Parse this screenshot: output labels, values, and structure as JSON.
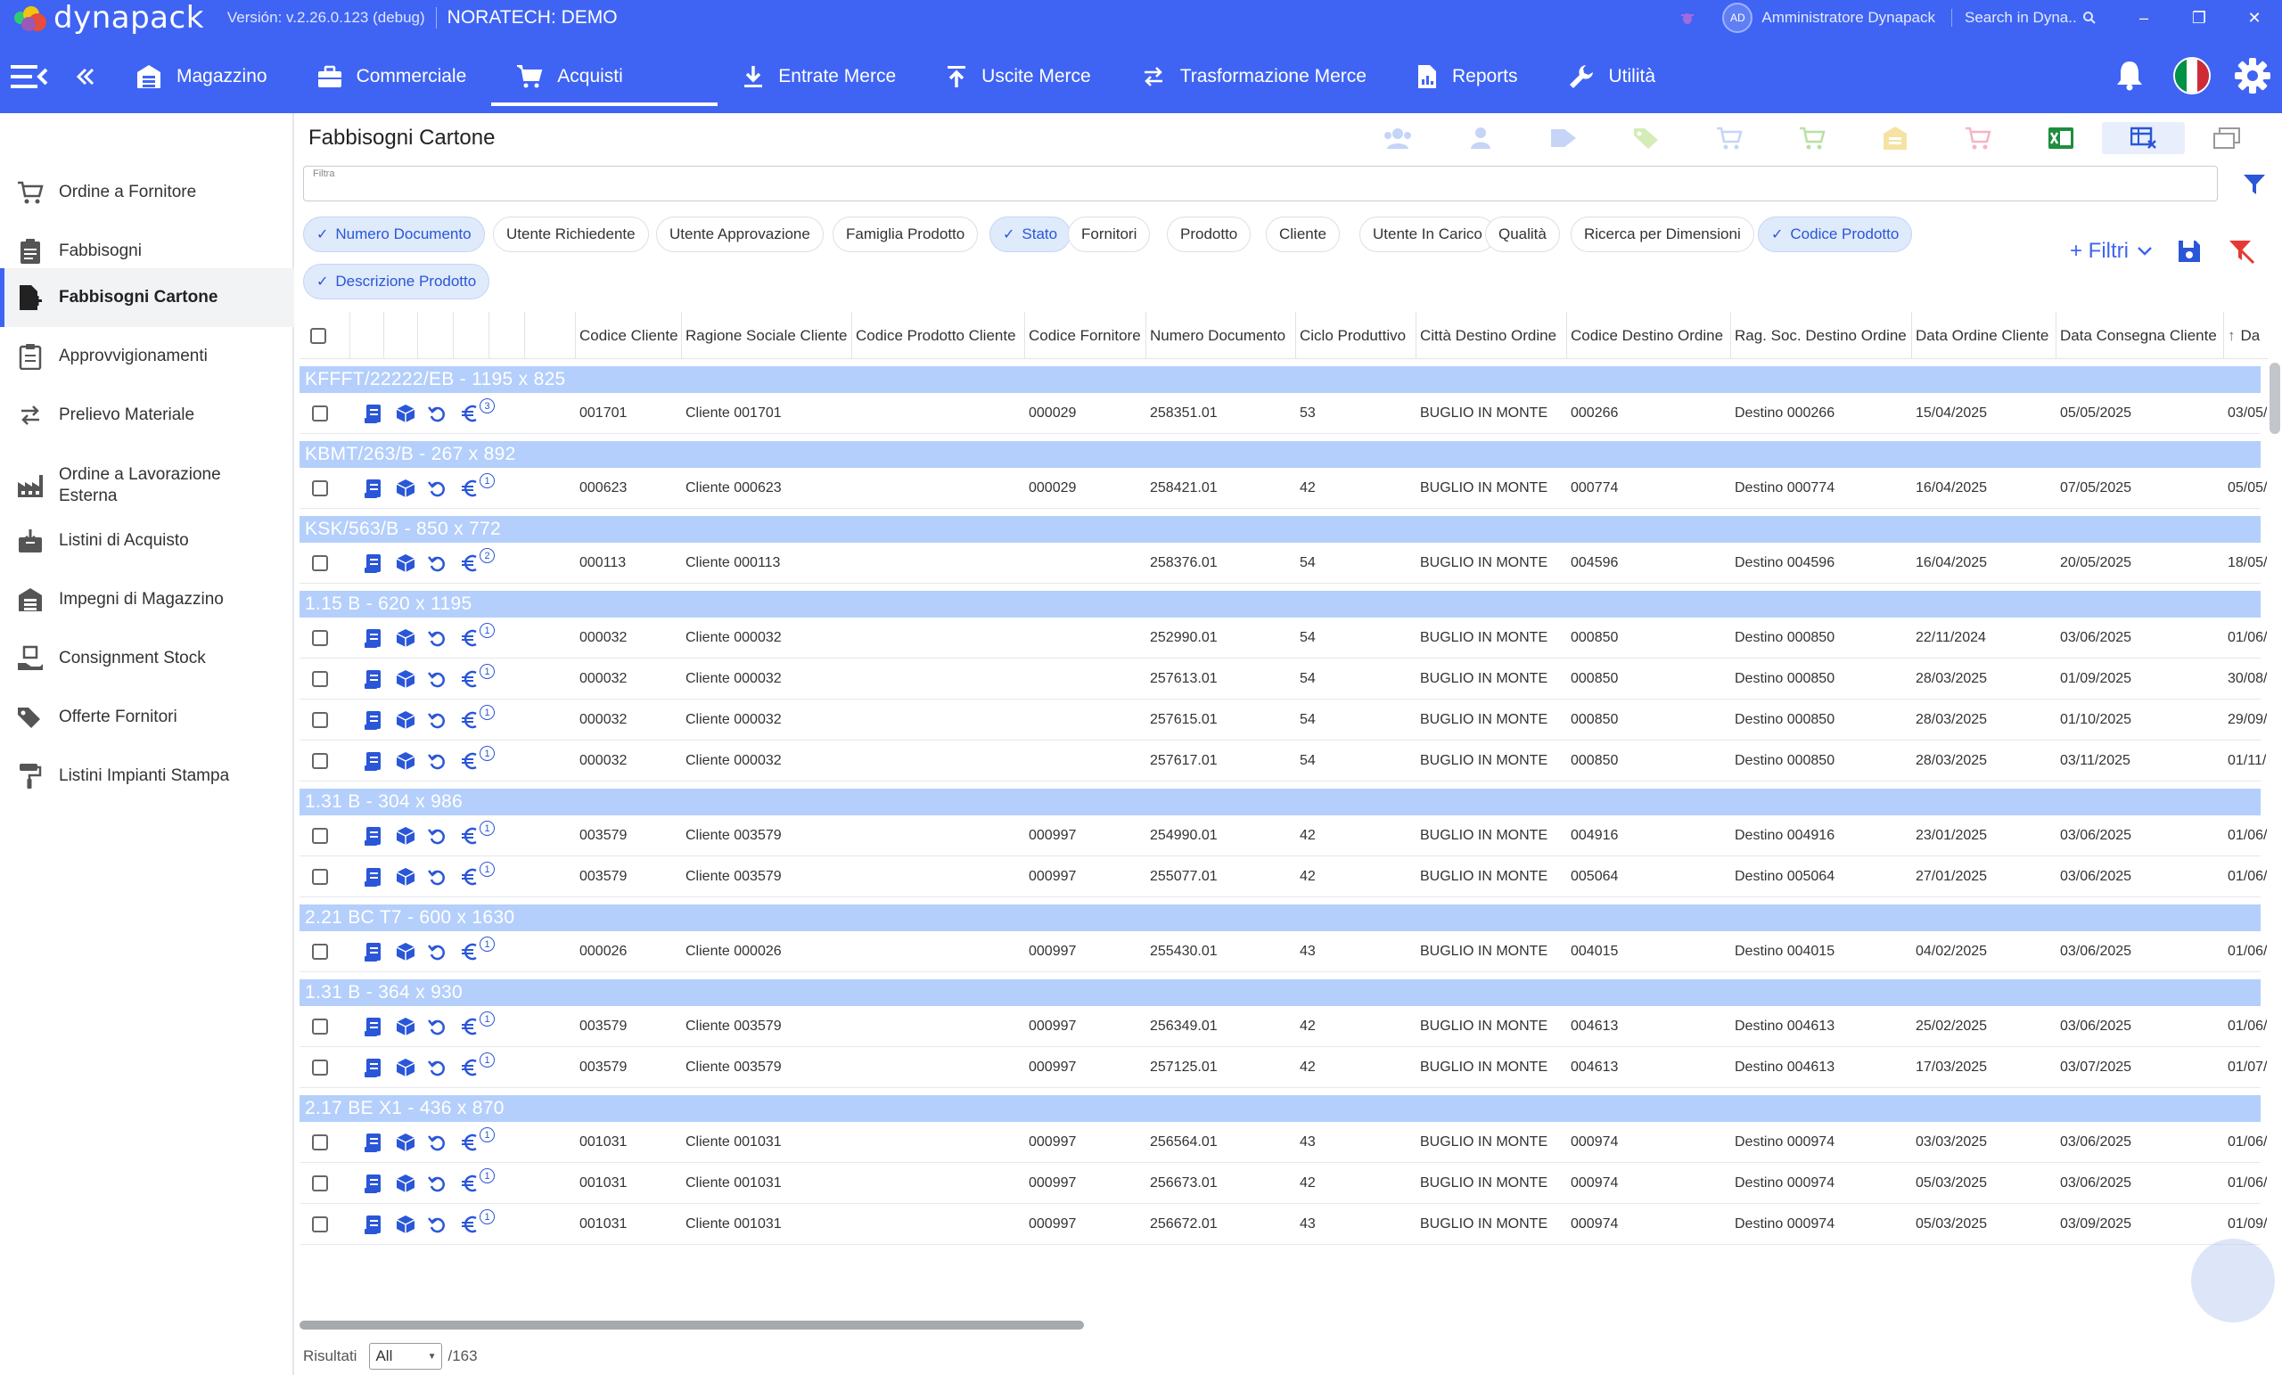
{
  "app": {
    "logo_text": "dynapack",
    "version": "Versión: v.2.26.0.123 (debug)",
    "company": "NORATECH: DEMO",
    "user_initials": "AD",
    "user_name": "Amministratore Dynapack",
    "search_placeholder": "Search in Dyna..",
    "brand_color": "#3f64f3"
  },
  "nav": [
    {
      "label": "Magazzino",
      "icon": "warehouse-icon"
    },
    {
      "label": "Commerciale",
      "icon": "briefcase-icon"
    },
    {
      "label": "Acquisti",
      "icon": "cart-icon",
      "active": true
    },
    {
      "label": "Entrate Merce",
      "icon": "download-icon"
    },
    {
      "label": "Uscite Merce",
      "icon": "upload-icon"
    },
    {
      "label": "Trasformazione Merce",
      "icon": "swap-icon"
    },
    {
      "label": "Reports",
      "icon": "report-icon"
    },
    {
      "label": "Utilità",
      "icon": "wrench-icon"
    }
  ],
  "sidebar": [
    {
      "label": "Ordine a Fornitore",
      "icon": "cart-icon"
    },
    {
      "label": "Fabbisogni",
      "icon": "clipboard-icon"
    },
    {
      "label": "Fabbisogni Cartone",
      "icon": "document-add-icon",
      "active": true
    },
    {
      "label": "Approvvigionamenti",
      "icon": "clipboard-list-icon"
    },
    {
      "label": "Prelievo Materiale",
      "icon": "transfer-icon"
    },
    {
      "label": "Ordine a Lavorazione Esterna",
      "icon": "factory-icon"
    },
    {
      "label": "Listini di Acquisto",
      "icon": "box-download-icon"
    },
    {
      "label": "Impegni di Magazzino",
      "icon": "warehouse-icon"
    },
    {
      "label": "Consignment Stock",
      "icon": "hand-box-icon"
    },
    {
      "label": "Offerte Fornitori",
      "icon": "tags-icon"
    },
    {
      "label": "Listini Impianti Stampa",
      "icon": "paint-roller-icon"
    }
  ],
  "page": {
    "title": "Fabbisogni Cartone",
    "filter_label": "Filtra",
    "filter_value": "",
    "filtri_label": "+ Filtri",
    "results_label": "Risultati",
    "results_select": "All",
    "results_total": "/163"
  },
  "chips": [
    {
      "label": "Numero Documento",
      "on": true
    },
    {
      "label": "Utente Richiedente",
      "on": false
    },
    {
      "label": "Utente Approvazione",
      "on": false
    },
    {
      "label": "Famiglia Prodotto",
      "on": false
    },
    {
      "label": "Stato",
      "on": true
    },
    {
      "label": "Fornitori",
      "on": false
    },
    {
      "label": "Prodotto",
      "on": false
    },
    {
      "label": "Cliente",
      "on": false
    },
    {
      "label": "Utente In Carico",
      "on": false
    },
    {
      "label": "Qualità",
      "on": false
    },
    {
      "label": "Ricerca per Dimensioni",
      "on": false
    },
    {
      "label": "Codice Prodotto",
      "on": true
    },
    {
      "label": "Descrizione Prodotto",
      "on": true
    }
  ],
  "columns": [
    "Codice Cliente",
    "Ragione Sociale Cliente",
    "Codice Prodotto Cliente",
    "Codice Fornitore",
    "Numero Documento",
    "Ciclo Produttivo",
    "Città Destino Ordine",
    "Codice Destino Ordine",
    "Rag. Soc. Destino Ordine",
    "Data Ordine Cliente",
    "Data Consegna Cliente",
    "Da"
  ],
  "groups": [
    {
      "title": "KFFFT/22222/EB  -  1195 x 825",
      "rows": [
        {
          "cc": "001701",
          "rs": "Cliente 001701",
          "cpc": "",
          "cf": "000029",
          "nd": "258351.01",
          "cp": "53",
          "city": "BUGLIO IN MONTE",
          "cdo": "000266",
          "rsd": "Destino 000266",
          "doc": "15/04/2025",
          "dcc": "05/05/2025",
          "da": "03/05/",
          "badge": "3"
        }
      ]
    },
    {
      "title": "KBMT/263/B  -  267 x 892",
      "rows": [
        {
          "cc": "000623",
          "rs": "Cliente 000623",
          "cpc": "",
          "cf": "000029",
          "nd": "258421.01",
          "cp": "42",
          "city": "BUGLIO IN MONTE",
          "cdo": "000774",
          "rsd": "Destino 000774",
          "doc": "16/04/2025",
          "dcc": "07/05/2025",
          "da": "05/05/",
          "badge": "1"
        }
      ]
    },
    {
      "title": "KSK/563/B  -  850 x 772",
      "rows": [
        {
          "cc": "000113",
          "rs": "Cliente 000113",
          "cpc": "",
          "cf": "",
          "nd": "258376.01",
          "cp": "54",
          "city": "BUGLIO IN MONTE",
          "cdo": "004596",
          "rsd": "Destino 004596",
          "doc": "16/04/2025",
          "dcc": "20/05/2025",
          "da": "18/05/",
          "badge": "2"
        }
      ]
    },
    {
      "title": "1.15 B  -  620 x 1195",
      "rows": [
        {
          "cc": "000032",
          "rs": "Cliente 000032",
          "cpc": "",
          "cf": "",
          "nd": "252990.01",
          "cp": "54",
          "city": "BUGLIO IN MONTE",
          "cdo": "000850",
          "rsd": "Destino 000850",
          "doc": "22/11/2024",
          "dcc": "03/06/2025",
          "da": "01/06/",
          "badge": "1"
        },
        {
          "cc": "000032",
          "rs": "Cliente 000032",
          "cpc": "",
          "cf": "",
          "nd": "257613.01",
          "cp": "54",
          "city": "BUGLIO IN MONTE",
          "cdo": "000850",
          "rsd": "Destino 000850",
          "doc": "28/03/2025",
          "dcc": "01/09/2025",
          "da": "30/08/",
          "badge": "1"
        },
        {
          "cc": "000032",
          "rs": "Cliente 000032",
          "cpc": "",
          "cf": "",
          "nd": "257615.01",
          "cp": "54",
          "city": "BUGLIO IN MONTE",
          "cdo": "000850",
          "rsd": "Destino 000850",
          "doc": "28/03/2025",
          "dcc": "01/10/2025",
          "da": "29/09/",
          "badge": "1"
        },
        {
          "cc": "000032",
          "rs": "Cliente 000032",
          "cpc": "",
          "cf": "",
          "nd": "257617.01",
          "cp": "54",
          "city": "BUGLIO IN MONTE",
          "cdo": "000850",
          "rsd": "Destino 000850",
          "doc": "28/03/2025",
          "dcc": "03/11/2025",
          "da": "01/11/",
          "badge": "1"
        }
      ]
    },
    {
      "title": "1.31 B  -  304 x 986",
      "rows": [
        {
          "cc": "003579",
          "rs": "Cliente 003579",
          "cpc": "",
          "cf": "000997",
          "nd": "254990.01",
          "cp": "42",
          "city": "BUGLIO IN MONTE",
          "cdo": "004916",
          "rsd": "Destino 004916",
          "doc": "23/01/2025",
          "dcc": "03/06/2025",
          "da": "01/06/",
          "badge": "1"
        },
        {
          "cc": "003579",
          "rs": "Cliente 003579",
          "cpc": "",
          "cf": "000997",
          "nd": "255077.01",
          "cp": "42",
          "city": "BUGLIO IN MONTE",
          "cdo": "005064",
          "rsd": "Destino 005064",
          "doc": "27/01/2025",
          "dcc": "03/06/2025",
          "da": "01/06/",
          "badge": "1"
        }
      ]
    },
    {
      "title": "2.21 BC T7  -  600 x 1630",
      "rows": [
        {
          "cc": "000026",
          "rs": "Cliente 000026",
          "cpc": "",
          "cf": "000997",
          "nd": "255430.01",
          "cp": "43",
          "city": "BUGLIO IN MONTE",
          "cdo": "004015",
          "rsd": "Destino 004015",
          "doc": "04/02/2025",
          "dcc": "03/06/2025",
          "da": "01/06/",
          "badge": "1"
        }
      ]
    },
    {
      "title": "1.31 B  -  364 x 930",
      "rows": [
        {
          "cc": "003579",
          "rs": "Cliente 003579",
          "cpc": "",
          "cf": "000997",
          "nd": "256349.01",
          "cp": "42",
          "city": "BUGLIO IN MONTE",
          "cdo": "004613",
          "rsd": "Destino 004613",
          "doc": "25/02/2025",
          "dcc": "03/06/2025",
          "da": "01/06/",
          "badge": "1"
        },
        {
          "cc": "003579",
          "rs": "Cliente 003579",
          "cpc": "",
          "cf": "000997",
          "nd": "257125.01",
          "cp": "42",
          "city": "BUGLIO IN MONTE",
          "cdo": "004613",
          "rsd": "Destino 004613",
          "doc": "17/03/2025",
          "dcc": "03/07/2025",
          "da": "01/07/",
          "badge": "1"
        }
      ]
    },
    {
      "title": "2.17 BE X1  -  436 x 870",
      "rows": [
        {
          "cc": "001031",
          "rs": "Cliente 001031",
          "cpc": "",
          "cf": "000997",
          "nd": "256564.01",
          "cp": "43",
          "city": "BUGLIO IN MONTE",
          "cdo": "000974",
          "rsd": "Destino 000974",
          "doc": "03/03/2025",
          "dcc": "03/06/2025",
          "da": "01/06/",
          "badge": "1"
        },
        {
          "cc": "001031",
          "rs": "Cliente 001031",
          "cpc": "",
          "cf": "000997",
          "nd": "256673.01",
          "cp": "42",
          "city": "BUGLIO IN MONTE",
          "cdo": "000974",
          "rsd": "Destino 000974",
          "doc": "05/03/2025",
          "dcc": "03/06/2025",
          "da": "01/06/",
          "badge": "1"
        },
        {
          "cc": "001031",
          "rs": "Cliente 001031",
          "cpc": "",
          "cf": "000997",
          "nd": "256672.01",
          "cp": "43",
          "city": "BUGLIO IN MONTE",
          "cdo": "000974",
          "rsd": "Destino 000974",
          "doc": "05/03/2025",
          "dcc": "03/09/2025",
          "da": "01/09/",
          "badge": "1"
        }
      ]
    }
  ]
}
